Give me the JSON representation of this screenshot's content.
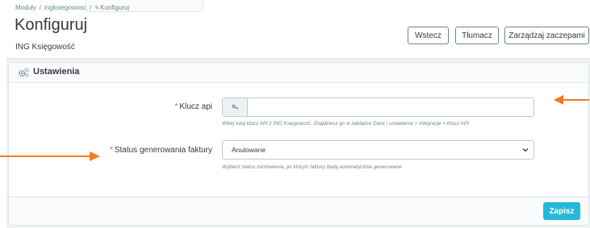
{
  "breadcrumb": {
    "items": [
      "Moduły",
      "ingksiegowosc",
      "Konfiguruj"
    ]
  },
  "header": {
    "title": "Konfiguruj",
    "subtitle": "ING Księgowość",
    "toolbar": {
      "back_label": "Wstecz",
      "translate_label": "Tłumacz",
      "hooks_label": "Zarządzaj zaczepami"
    }
  },
  "settings": {
    "title": "Ustawienia",
    "api_key": {
      "label": "Klucz api",
      "value": "",
      "help": "Wklej tutaj klucz API z ING Księgowość. Znajdziesz go w zakładce Dane i ustawienia > Integracje > Klucz API."
    },
    "invoice_status": {
      "label": "Status generowania faktury",
      "selected": "Anulowane",
      "help": "Wybierz status zamówienia, po którym faktury będą automatycznie generowane"
    },
    "save_label": "Zapisz"
  },
  "colors": {
    "accent": "#25b9d7",
    "annotation_arrow": "#f47a20",
    "required_mark": "#c05c67"
  }
}
